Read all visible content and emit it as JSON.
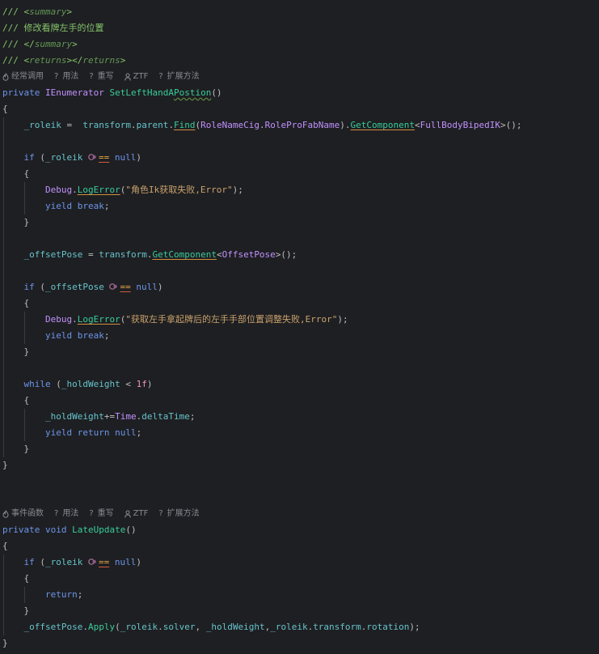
{
  "lines": [
    {
      "tokens": [
        {
          "t": "/// <",
          "c": "#85c46c"
        },
        {
          "t": "summary",
          "c": "#629755",
          "i": true
        },
        {
          "t": ">",
          "c": "#85c46c"
        }
      ]
    },
    {
      "tokens": [
        {
          "t": "/// 修改看牌左手的位置",
          "c": "#85c46c"
        }
      ]
    },
    {
      "tokens": [
        {
          "t": "/// </",
          "c": "#85c46c"
        },
        {
          "t": "summary",
          "c": "#629755",
          "i": true
        },
        {
          "t": ">",
          "c": "#85c46c"
        }
      ]
    },
    {
      "tokens": [
        {
          "t": "/// <",
          "c": "#85c46c"
        },
        {
          "t": "returns",
          "c": "#629755",
          "i": true
        },
        {
          "t": "></",
          "c": "#85c46c"
        },
        {
          "t": "returns",
          "c": "#629755",
          "i": true
        },
        {
          "t": ">",
          "c": "#85c46c"
        }
      ]
    },
    {
      "hints": [
        {
          "icon": "flame-icon",
          "label": "经常调用"
        },
        {
          "glyph": "?",
          "label": "用法"
        },
        {
          "glyph": "?",
          "label": "重写"
        },
        {
          "icon": "user-icon",
          "label": "ZTF"
        },
        {
          "glyph": "?",
          "label": "扩展方法"
        }
      ]
    },
    {
      "tokens": [
        {
          "t": "private",
          "c": "#6c95eb"
        },
        {
          "t": " ",
          "c": "#bdbdbd"
        },
        {
          "t": "IEnumerator",
          "c": "#c191ff"
        },
        {
          "t": " ",
          "c": "#bdbdbd"
        },
        {
          "t": "SetLeftHandA",
          "c": "#39cc9b"
        },
        {
          "t": "Postion",
          "c": "#39cc9b",
          "w": "#5f8a45"
        },
        {
          "t": "()",
          "c": "#bdbdbd"
        }
      ]
    },
    {
      "tokens": [
        {
          "t": "{",
          "c": "#bdbdbd"
        }
      ]
    },
    {
      "tokens": [
        {
          "t": "    ",
          "c": "#bdbdbd"
        },
        {
          "t": "_roleik",
          "c": "#66c3cc"
        },
        {
          "t": " =  ",
          "c": "#bdbdbd"
        },
        {
          "t": "transform",
          "c": "#66c3cc"
        },
        {
          "t": ".",
          "c": "#bdbdbd"
        },
        {
          "t": "parent",
          "c": "#66c3cc"
        },
        {
          "t": ".",
          "c": "#bdbdbd"
        },
        {
          "t": "Find",
          "c": "#39cc9b",
          "u": "#cf8e3f"
        },
        {
          "t": "(",
          "c": "#bdbdbd"
        },
        {
          "t": "RoleNameCig",
          "c": "#c191ff"
        },
        {
          "t": ".",
          "c": "#bdbdbd"
        },
        {
          "t": "RoleProFabName",
          "c": "#c191ff"
        },
        {
          "t": ").",
          "c": "#bdbdbd"
        },
        {
          "t": "GetComponent",
          "c": "#39cc9b",
          "u": "#cf8e3f"
        },
        {
          "t": "<",
          "c": "#bdbdbd"
        },
        {
          "t": "FullBodyBipedIK",
          "c": "#c191ff"
        },
        {
          "t": ">();",
          "c": "#bdbdbd"
        }
      ]
    },
    {
      "tokens": []
    },
    {
      "tokens": [
        {
          "t": "    ",
          "c": "#bdbdbd"
        },
        {
          "t": "if",
          "c": "#6c95eb"
        },
        {
          "t": " (",
          "c": "#bdbdbd"
        },
        {
          "t": "_roleik",
          "c": "#66c3cc"
        },
        {
          "t": " ",
          "c": "#bdbdbd"
        },
        {
          "icon": "unity-lifetime-check-icon"
        },
        {
          "t": "==",
          "c": "#e5a54a",
          "u": "#d05d3d"
        },
        {
          "t": " ",
          "c": "#bdbdbd"
        },
        {
          "t": "null",
          "c": "#6c95eb"
        },
        {
          "t": ")",
          "c": "#bdbdbd"
        }
      ]
    },
    {
      "tokens": [
        {
          "t": "    {",
          "c": "#bdbdbd"
        }
      ]
    },
    {
      "tokens": [
        {
          "t": "        ",
          "c": "#bdbdbd"
        },
        {
          "t": "Debug",
          "c": "#c191ff"
        },
        {
          "t": ".",
          "c": "#bdbdbd"
        },
        {
          "t": "LogError",
          "c": "#39cc9b",
          "u": "#cf8e3f"
        },
        {
          "t": "(",
          "c": "#bdbdbd"
        },
        {
          "t": "\"角色Ik获取失败,Error\"",
          "c": "#c9a26d"
        },
        {
          "t": ");",
          "c": "#bdbdbd"
        }
      ]
    },
    {
      "tokens": [
        {
          "t": "        ",
          "c": "#bdbdbd"
        },
        {
          "t": "yield",
          "c": "#6c95eb"
        },
        {
          "t": " ",
          "c": "#bdbdbd"
        },
        {
          "t": "break",
          "c": "#6c95eb"
        },
        {
          "t": ";",
          "c": "#bdbdbd"
        }
      ]
    },
    {
      "tokens": [
        {
          "t": "    }",
          "c": "#bdbdbd"
        }
      ]
    },
    {
      "tokens": []
    },
    {
      "tokens": [
        {
          "t": "    ",
          "c": "#bdbdbd"
        },
        {
          "t": "_offsetPose",
          "c": "#66c3cc"
        },
        {
          "t": " = ",
          "c": "#bdbdbd"
        },
        {
          "t": "transform",
          "c": "#66c3cc"
        },
        {
          "t": ".",
          "c": "#bdbdbd"
        },
        {
          "t": "GetComponent",
          "c": "#39cc9b",
          "u": "#cf8e3f"
        },
        {
          "t": "<",
          "c": "#bdbdbd"
        },
        {
          "t": "OffsetPose",
          "c": "#c191ff"
        },
        {
          "t": ">();",
          "c": "#bdbdbd"
        }
      ]
    },
    {
      "tokens": []
    },
    {
      "tokens": [
        {
          "t": "    ",
          "c": "#bdbdbd"
        },
        {
          "t": "if",
          "c": "#6c95eb"
        },
        {
          "t": " (",
          "c": "#bdbdbd"
        },
        {
          "t": "_offsetPose",
          "c": "#66c3cc"
        },
        {
          "t": " ",
          "c": "#bdbdbd"
        },
        {
          "icon": "unity-lifetime-check-icon"
        },
        {
          "t": "==",
          "c": "#e5a54a",
          "u": "#d05d3d"
        },
        {
          "t": " ",
          "c": "#bdbdbd"
        },
        {
          "t": "null",
          "c": "#6c95eb"
        },
        {
          "t": ")",
          "c": "#bdbdbd"
        }
      ]
    },
    {
      "tokens": [
        {
          "t": "    {",
          "c": "#bdbdbd"
        }
      ]
    },
    {
      "tokens": [
        {
          "t": "        ",
          "c": "#bdbdbd"
        },
        {
          "t": "Debug",
          "c": "#c191ff"
        },
        {
          "t": ".",
          "c": "#bdbdbd"
        },
        {
          "t": "LogError",
          "c": "#39cc9b",
          "u": "#cf8e3f"
        },
        {
          "t": "(",
          "c": "#bdbdbd"
        },
        {
          "t": "\"获取左手拿起牌后的左手手部位置调整失败,Error\"",
          "c": "#c9a26d"
        },
        {
          "t": ");",
          "c": "#bdbdbd"
        }
      ]
    },
    {
      "tokens": [
        {
          "t": "        ",
          "c": "#bdbdbd"
        },
        {
          "t": "yield",
          "c": "#6c95eb"
        },
        {
          "t": " ",
          "c": "#bdbdbd"
        },
        {
          "t": "break",
          "c": "#6c95eb"
        },
        {
          "t": ";",
          "c": "#bdbdbd"
        }
      ]
    },
    {
      "tokens": [
        {
          "t": "    }",
          "c": "#bdbdbd"
        }
      ]
    },
    {
      "tokens": []
    },
    {
      "tokens": [
        {
          "t": "    ",
          "c": "#bdbdbd"
        },
        {
          "t": "while",
          "c": "#6c95eb"
        },
        {
          "t": " (",
          "c": "#bdbdbd"
        },
        {
          "t": "_holdWeight",
          "c": "#66c3cc"
        },
        {
          "t": " < ",
          "c": "#bdbdbd"
        },
        {
          "t": "1f",
          "c": "#ed94c0"
        },
        {
          "t": ")",
          "c": "#bdbdbd"
        }
      ]
    },
    {
      "tokens": [
        {
          "t": "    {",
          "c": "#bdbdbd"
        }
      ]
    },
    {
      "tokens": [
        {
          "t": "        ",
          "c": "#bdbdbd"
        },
        {
          "t": "_holdWeight",
          "c": "#66c3cc"
        },
        {
          "t": "+=",
          "c": "#bdbdbd"
        },
        {
          "t": "Time",
          "c": "#c191ff"
        },
        {
          "t": ".",
          "c": "#bdbdbd"
        },
        {
          "t": "deltaTime",
          "c": "#66c3cc"
        },
        {
          "t": ";",
          "c": "#bdbdbd"
        }
      ]
    },
    {
      "tokens": [
        {
          "t": "        ",
          "c": "#bdbdbd"
        },
        {
          "t": "yield",
          "c": "#6c95eb"
        },
        {
          "t": " ",
          "c": "#bdbdbd"
        },
        {
          "t": "return",
          "c": "#6c95eb"
        },
        {
          "t": " ",
          "c": "#bdbdbd"
        },
        {
          "t": "null",
          "c": "#6c95eb"
        },
        {
          "t": ";",
          "c": "#bdbdbd"
        }
      ]
    },
    {
      "tokens": [
        {
          "t": "    }",
          "c": "#bdbdbd"
        }
      ]
    },
    {
      "tokens": [
        {
          "t": "}",
          "c": "#bdbdbd"
        }
      ]
    },
    {
      "tokens": []
    },
    {
      "tokens": []
    },
    {
      "hints": [
        {
          "icon": "flame-icon",
          "label": "事件函数"
        },
        {
          "glyph": "?",
          "label": "用法"
        },
        {
          "glyph": "?",
          "label": "重写"
        },
        {
          "icon": "user-icon",
          "label": "ZTF"
        },
        {
          "glyph": "?",
          "label": "扩展方法"
        }
      ]
    },
    {
      "tokens": [
        {
          "t": "private",
          "c": "#6c95eb"
        },
        {
          "t": " ",
          "c": "#bdbdbd"
        },
        {
          "t": "void",
          "c": "#6c95eb"
        },
        {
          "t": " ",
          "c": "#bdbdbd"
        },
        {
          "t": "LateUpdate",
          "c": "#39cc9b"
        },
        {
          "t": "()",
          "c": "#bdbdbd"
        }
      ]
    },
    {
      "tokens": [
        {
          "t": "{",
          "c": "#bdbdbd"
        }
      ]
    },
    {
      "tokens": [
        {
          "t": "    ",
          "c": "#bdbdbd"
        },
        {
          "t": "if",
          "c": "#6c95eb"
        },
        {
          "t": " (",
          "c": "#bdbdbd"
        },
        {
          "t": "_roleik",
          "c": "#66c3cc"
        },
        {
          "t": " ",
          "c": "#bdbdbd"
        },
        {
          "icon": "unity-lifetime-check-icon"
        },
        {
          "t": "==",
          "c": "#e5a54a",
          "u": "#d05d3d"
        },
        {
          "t": " ",
          "c": "#bdbdbd"
        },
        {
          "t": "null",
          "c": "#6c95eb"
        },
        {
          "t": ")",
          "c": "#bdbdbd"
        }
      ]
    },
    {
      "tokens": [
        {
          "t": "    {",
          "c": "#bdbdbd"
        }
      ]
    },
    {
      "tokens": [
        {
          "t": "        ",
          "c": "#bdbdbd"
        },
        {
          "t": "return",
          "c": "#6c95eb"
        },
        {
          "t": ";",
          "c": "#bdbdbd"
        }
      ]
    },
    {
      "tokens": [
        {
          "t": "    }",
          "c": "#bdbdbd"
        }
      ]
    },
    {
      "tokens": [
        {
          "t": "    ",
          "c": "#bdbdbd"
        },
        {
          "t": "_offsetPose",
          "c": "#66c3cc"
        },
        {
          "t": ".",
          "c": "#bdbdbd"
        },
        {
          "t": "Apply",
          "c": "#39cc9b"
        },
        {
          "t": "(",
          "c": "#bdbdbd"
        },
        {
          "t": "_roleik",
          "c": "#66c3cc"
        },
        {
          "t": ".",
          "c": "#bdbdbd"
        },
        {
          "t": "solver",
          "c": "#66c3cc"
        },
        {
          "t": ", ",
          "c": "#bdbdbd"
        },
        {
          "t": "_holdWeight",
          "c": "#66c3cc"
        },
        {
          "t": ",",
          "c": "#bdbdbd"
        },
        {
          "t": "_roleik",
          "c": "#66c3cc"
        },
        {
          "t": ".",
          "c": "#bdbdbd"
        },
        {
          "t": "transform",
          "c": "#66c3cc"
        },
        {
          "t": ".",
          "c": "#bdbdbd"
        },
        {
          "t": "rotation",
          "c": "#66c3cc"
        },
        {
          "t": ");",
          "c": "#bdbdbd"
        }
      ]
    },
    {
      "tokens": [
        {
          "t": "}",
          "c": "#bdbdbd"
        }
      ]
    }
  ]
}
